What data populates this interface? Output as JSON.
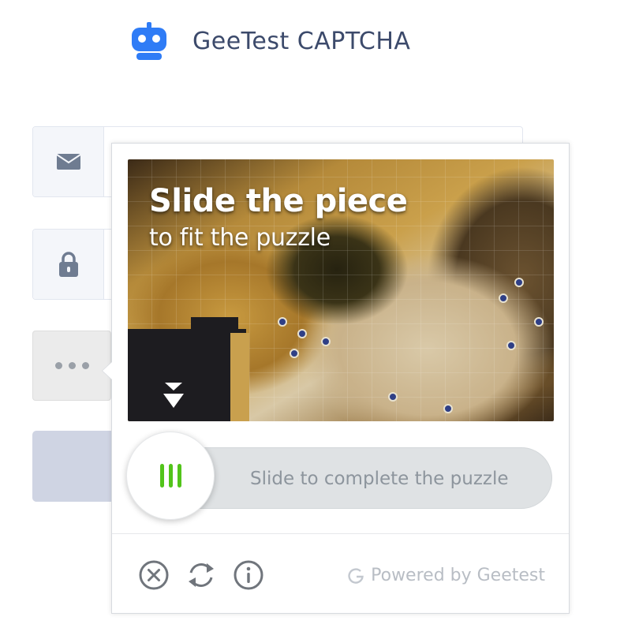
{
  "header": {
    "title": "GeeTest CAPTCHA",
    "logo_icon": "robot-icon",
    "brand_color": "#2f7cf6"
  },
  "form": {
    "email_icon": "mail-icon",
    "password_icon": "lock-icon",
    "captcha_trigger_icon": "ellipsis-icon",
    "submit_color": "#cfd4e3"
  },
  "captcha": {
    "puzzle": {
      "title": "Slide the piece",
      "subtitle": "to fit the puzzle",
      "hint_icon": "down-arrow-icon"
    },
    "slider": {
      "label": "Slide to complete the puzzle",
      "handle_icon": "grip-bars-icon",
      "handle_color": "#52c41a",
      "progress": 0
    },
    "footer": {
      "close_icon": "close-icon",
      "refresh_icon": "refresh-icon",
      "info_icon": "info-icon",
      "powered_by": "Powered by Geetest"
    }
  }
}
